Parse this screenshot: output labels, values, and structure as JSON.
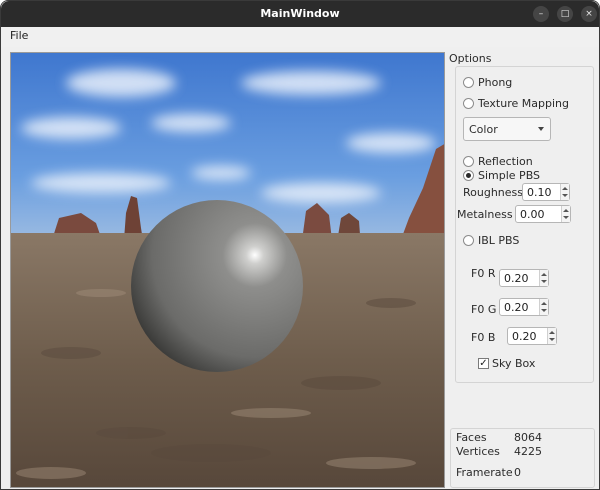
{
  "window": {
    "title": "MainWindow",
    "minimize": "–",
    "maximize": "□",
    "close": "×"
  },
  "menu": {
    "file": "File"
  },
  "options": {
    "title": "Options",
    "phong": "Phong",
    "texture_mapping": "Texture Mapping",
    "texture_select": "Color",
    "reflection": "Reflection",
    "simple_pbs": "Simple PBS",
    "selected_mode": "Simple PBS",
    "roughness_label": "Roughness",
    "roughness_value": "0.10",
    "metalness_label": "Metalness",
    "metalness_value": "0.00",
    "ibl_pbs": "IBL PBS",
    "f0r_label": "F0 R",
    "f0r_value": "0.20",
    "f0g_label": "F0 G",
    "f0g_value": "0.20",
    "f0b_label": "F0 B",
    "f0b_value": "0.20",
    "skybox_label": "Sky Box",
    "skybox_checked": true
  },
  "stats": {
    "faces_label": "Faces",
    "faces_value": "8064",
    "vertices_label": "Vertices",
    "vertices_value": "4225",
    "framerate_label": "Framerate",
    "framerate_value": "0"
  },
  "icons": {
    "check": "✓"
  },
  "colors": {
    "titlebar": "#2b2b2b",
    "window_bg": "#efefef",
    "sphere": "#7c7c7a",
    "sky": "#5b8ed6"
  }
}
